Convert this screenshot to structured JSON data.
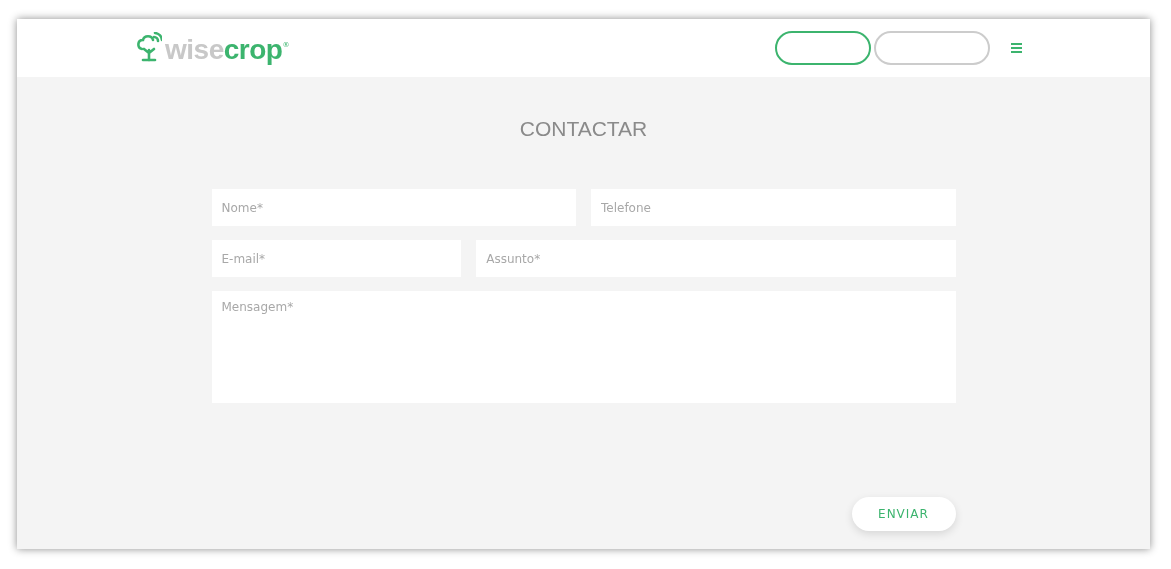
{
  "header": {
    "logo": {
      "wise": "wise",
      "crop": "crop",
      "mark": "®"
    },
    "buttons": [
      {
        "kind": "outlined-green"
      },
      {
        "kind": "outlined-grey"
      }
    ]
  },
  "title": "CONTACTAR",
  "form": {
    "rows": [
      [
        {
          "placeholder": "Nome*"
        },
        {
          "placeholder": "Telefone"
        }
      ],
      [
        {
          "placeholder": "E-mail*"
        },
        {
          "placeholder": "Assunto*"
        }
      ]
    ],
    "message": {
      "placeholder": "Mensagem*"
    },
    "submit": "ENVIAR"
  }
}
